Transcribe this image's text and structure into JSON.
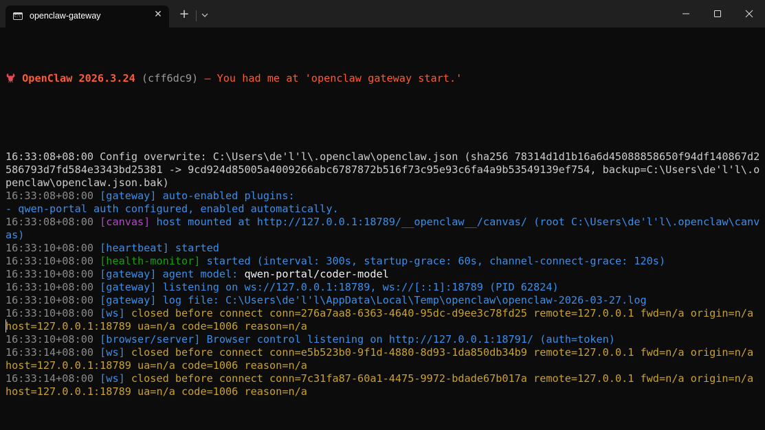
{
  "window": {
    "tab_title": "openclaw-gateway",
    "tab_icon": "terminal-icon",
    "close_tab_label": "✕",
    "new_tab_label": "+",
    "dropdown_icon": "chevron-down-icon",
    "minimize_icon": "minimize-icon",
    "maximize_icon": "maximize-icon",
    "close_icon": "close-icon"
  },
  "banner": {
    "app_name": "OpenClaw 2026.3.24",
    "commit": "(cff6dc9)",
    "dash": " — ",
    "tagline": "You had me at 'openclaw gateway start.'"
  },
  "colors": {
    "background": "#0c0c0c",
    "titlebar": "#202020",
    "timestamp": "#8a8a8a",
    "gateway": "#3b8eea",
    "canvas": "#b148c6",
    "health": "#13a10e",
    "warning": "#c9a230",
    "banner": "#ff5a36"
  },
  "log": [
    [
      {
        "t": "16:33:08+08:00 Config overwrite: C:\\Users\\de'l'l\\.openclaw\\openclaw.json (sha256 78314d1d1b16a6d45088858650f94df140867d2",
        "c": "c-white"
      }
    ],
    [
      {
        "t": "586793d7fd584e3343bd25381 -> 9cd924d85005a4009266abc6787872b516f73c95e93c6fa4a9b53549139ef754, backup=C:\\Users\\de'l'l\\.o",
        "c": "c-white"
      }
    ],
    [
      {
        "t": "penclaw\\openclaw.json.bak)",
        "c": "c-white"
      }
    ],
    [
      {
        "t": "16:33:08+08:00 ",
        "c": "c-time"
      },
      {
        "t": "[gateway] auto-enabled plugins:",
        "c": "c-blue"
      }
    ],
    [
      {
        "t": "- qwen-portal auth configured, enabled automatically.",
        "c": "c-blue"
      }
    ],
    [
      {
        "t": "16:33:08+08:00 ",
        "c": "c-time"
      },
      {
        "t": "[canvas]",
        "c": "c-magenta"
      },
      {
        "t": " host mounted at http://127.0.0.1:18789/__openclaw__/canvas/ (root C:\\Users\\de'l'l\\.openclaw\\canv",
        "c": "c-blue"
      }
    ],
    [
      {
        "t": "as)",
        "c": "c-blue"
      }
    ],
    [
      {
        "t": "16:33:10+08:00 ",
        "c": "c-time"
      },
      {
        "t": "[heartbeat] started",
        "c": "c-blue"
      }
    ],
    [
      {
        "t": "16:33:10+08:00 ",
        "c": "c-time"
      },
      {
        "t": "[health-monitor]",
        "c": "c-green"
      },
      {
        "t": " started (interval: 300s, startup-grace: 60s, channel-connect-grace: 120s)",
        "c": "c-blue"
      }
    ],
    [
      {
        "t": "16:33:10+08:00 ",
        "c": "c-time"
      },
      {
        "t": "[gateway] agent model: ",
        "c": "c-blue"
      },
      {
        "t": "qwen-portal/coder-model",
        "c": "c-bright"
      }
    ],
    [
      {
        "t": "16:33:10+08:00 ",
        "c": "c-time"
      },
      {
        "t": "[gateway] listening on ws://127.0.0.1:18789, ws://[::1]:18789 (PID 62824)",
        "c": "c-blue"
      }
    ],
    [
      {
        "t": "16:33:10+08:00 ",
        "c": "c-time"
      },
      {
        "t": "[gateway] log file: C:\\Users\\de'l'l\\AppData\\Local\\Temp\\openclaw\\openclaw-2026-03-27.log",
        "c": "c-blue"
      }
    ],
    [
      {
        "t": "16:33:10+08:00 ",
        "c": "c-time"
      },
      {
        "t": "[ws]",
        "c": "c-blue"
      },
      {
        "t": " closed before connect conn=276a7aa8-6363-4640-95dc-d9ee3c78fd25 remote=127.0.0.1 fwd=n/a origin=n/a",
        "c": "c-yellow"
      }
    ],
    [
      {
        "t": "host=127.0.0.1:18789 ua=n/a code=1006 reason=n/a",
        "c": "c-yellow"
      }
    ],
    [
      {
        "t": "16:33:10+08:00 ",
        "c": "c-time"
      },
      {
        "t": "[browser/server] Browser control listening on http://127.0.0.1:18791/ (auth=token)",
        "c": "c-blue"
      }
    ],
    [
      {
        "t": "16:33:14+08:00 ",
        "c": "c-time"
      },
      {
        "t": "[ws]",
        "c": "c-blue"
      },
      {
        "t": " closed before connect conn=e5b523b0-9f1d-4880-8d93-1da850db34b9 remote=127.0.0.1 fwd=n/a origin=n/a",
        "c": "c-yellow"
      }
    ],
    [
      {
        "t": "host=127.0.0.1:18789 ua=n/a code=1006 reason=n/a",
        "c": "c-yellow"
      }
    ],
    [
      {
        "t": "16:33:14+08:00 ",
        "c": "c-time"
      },
      {
        "t": "[ws]",
        "c": "c-blue"
      },
      {
        "t": " closed before connect conn=7c31fa87-60a1-4475-9972-bdade67b017a remote=127.0.0.1 fwd=n/a origin=n/a",
        "c": "c-yellow"
      }
    ],
    [
      {
        "t": "host=127.0.0.1:18789 ua=n/a code=1006 reason=n/a",
        "c": "c-yellow"
      }
    ]
  ]
}
